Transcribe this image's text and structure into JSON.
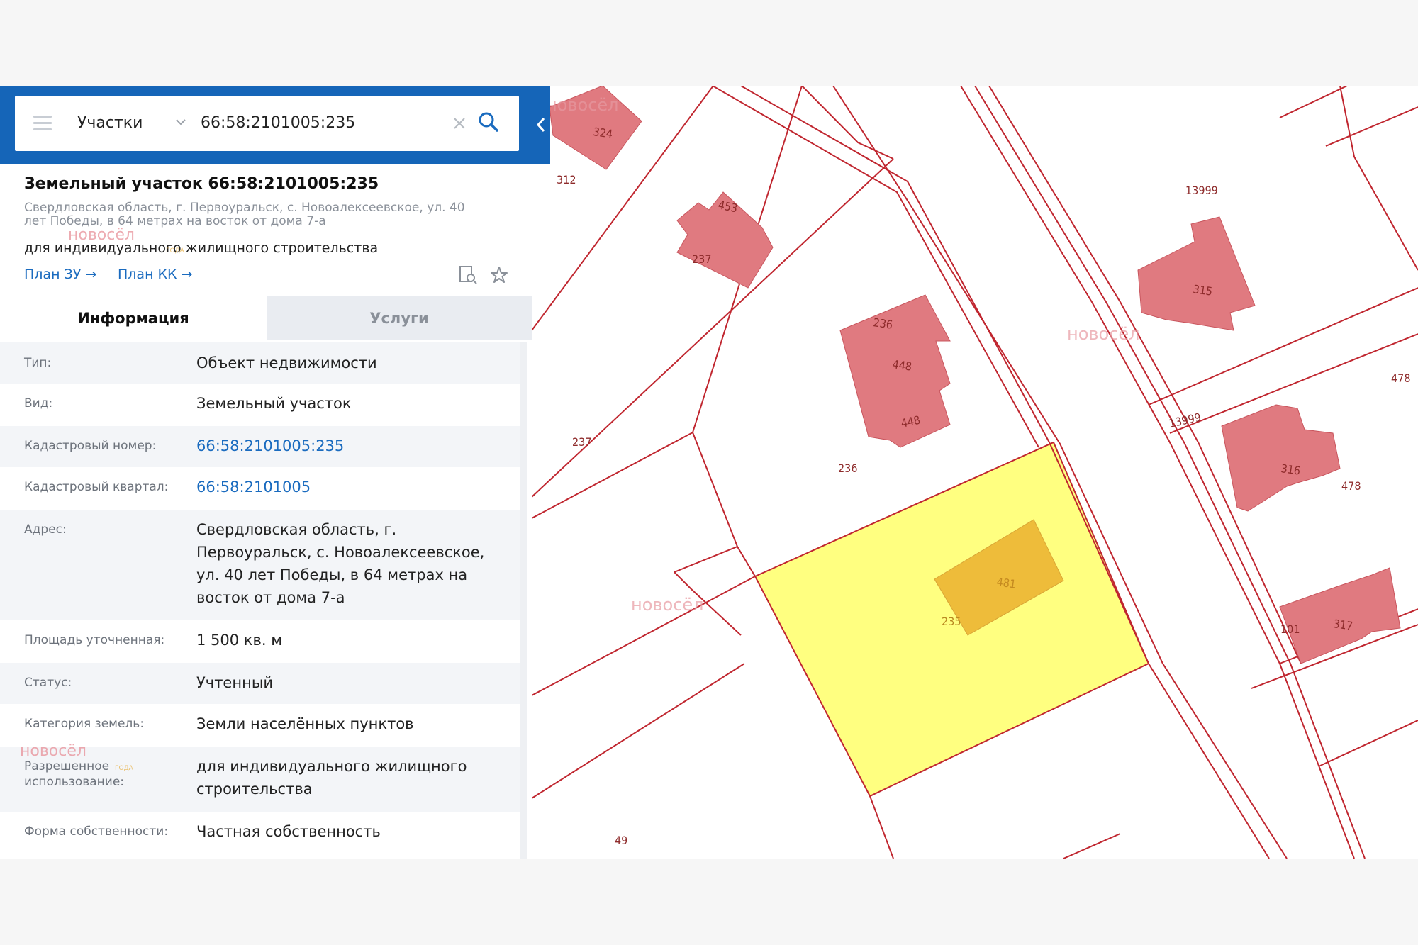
{
  "search": {
    "layer": "Участки",
    "value": "66:58:2101005:235"
  },
  "object": {
    "title": "Земельный участок 66:58:2101005:235",
    "address": "Свердловская область, г. Первоуральск, с. Новоалексеевское, ул. 40 лет Победы, в 64 метрах на восток от дома 7-а",
    "permitted_use": "для индивидуального жилищного строительства",
    "links": {
      "plan_zu": "План ЗУ →",
      "plan_kk": "План КК →"
    }
  },
  "tabs": {
    "info": "Информация",
    "services": "Услуги"
  },
  "info_rows": [
    {
      "label": "Тип:",
      "value": "Объект недвижимости"
    },
    {
      "label": "Вид:",
      "value": "Земельный участок"
    },
    {
      "label": "Кадастровый номер:",
      "value": "66:58:2101005:235"
    },
    {
      "label": "Кадастровый квартал:",
      "value": "66:58:2101005"
    },
    {
      "label": "Адрес:",
      "value": "Свердловская область, г. Первоуральск, с. Новоалексеевское, ул. 40 лет Победы, в 64 метрах на восток от дома 7-а"
    },
    {
      "label": "Площадь уточненная:",
      "value": "1 500 кв. м"
    },
    {
      "label": "Статус:",
      "value": "Учтенный"
    },
    {
      "label": "Категория земель:",
      "value": "Земли населённых пунктов"
    },
    {
      "label": "Разрешенное использование:",
      "value": "для индивидуального жилищного строительства"
    },
    {
      "label": "Форма собственности:",
      "value": "Частная собственность"
    }
  ],
  "watermark": {
    "brand": "новосёл",
    "badge": "ГОДА"
  },
  "map": {
    "colors": {
      "boundary": "#c0262f",
      "building": "#e07a80",
      "selected_parcel": "#ffff80",
      "selected_building": "#eebc3a"
    },
    "labels": {
      "l324": "324",
      "l312": "312",
      "l453": "453",
      "l237a": "237",
      "l13999a": "13999",
      "l315": "315",
      "l236a": "236",
      "l448a": "448",
      "l448b": "448",
      "l237b": "237",
      "l236b": "236",
      "l13999b": "13999",
      "l478a": "478",
      "l316": "316",
      "l478b": "478",
      "l481": "481",
      "l235": "235",
      "l101": "101",
      "l317": "317",
      "l49": "49"
    }
  }
}
